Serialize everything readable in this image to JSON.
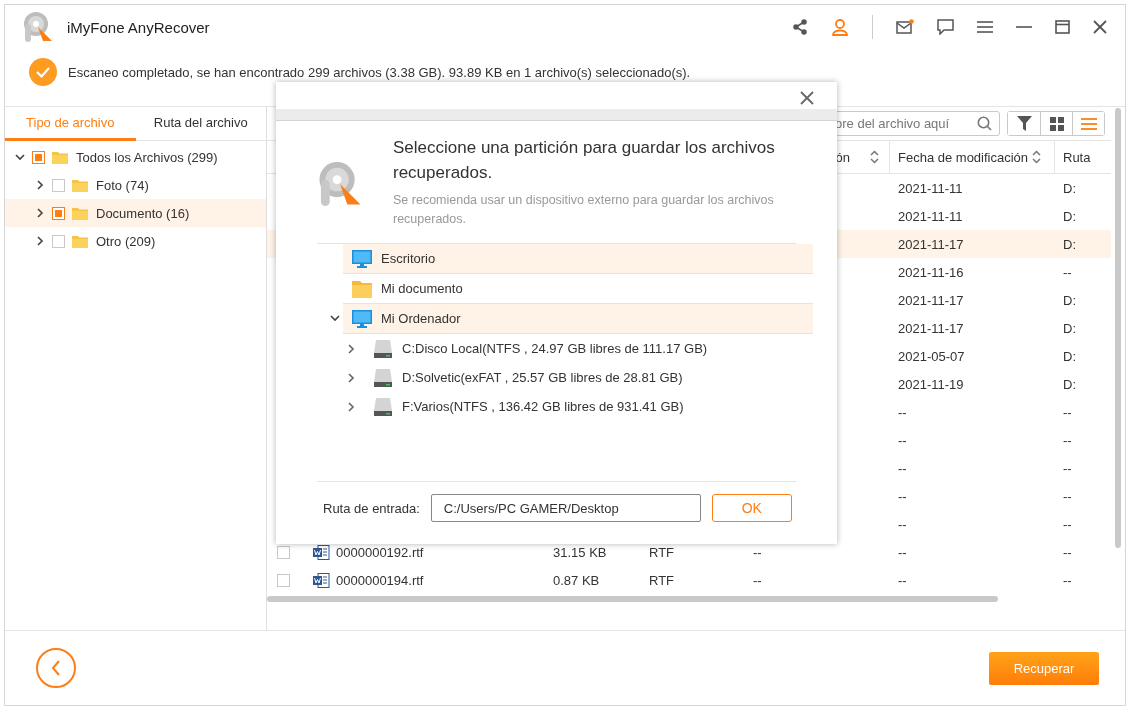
{
  "window": {
    "title": "iMyFone AnyRecover"
  },
  "status": {
    "message": "Escaneo completado, se han encontrado 299 archivos (3.38 GB). 93.89 KB en 1 archivo(s) seleccionado(s)."
  },
  "sidebar": {
    "tabs": [
      {
        "label": "Tipo de archivo",
        "selected": true
      },
      {
        "label": "Ruta del archivo",
        "selected": false
      }
    ],
    "tree": [
      {
        "label": "Todos los Archivos (299)",
        "indeterminate": true,
        "expanded": true,
        "selected": false,
        "children": [
          {
            "label": "Foto (74)",
            "indeterminate": false,
            "expanded": false,
            "selected": false
          },
          {
            "label": "Documento (16)",
            "indeterminate": true,
            "expanded": false,
            "selected": true
          },
          {
            "label": "Otro (209)",
            "indeterminate": false,
            "expanded": false,
            "selected": false
          }
        ]
      }
    ]
  },
  "search": {
    "placeholder": "ore del archivo aquí"
  },
  "view_buttons": [
    {
      "kind": "filter",
      "selected": false
    },
    {
      "kind": "grid",
      "selected": false
    },
    {
      "kind": "list",
      "selected": true
    }
  ],
  "table": {
    "columns": [
      {
        "label": "ón",
        "sortable": true
      },
      {
        "label": "Fecha de modificación",
        "sortable": true
      },
      {
        "label": "Ruta",
        "sortable": false
      }
    ],
    "rows": [
      {
        "modified": "2021-11-11",
        "path": "D:",
        "selected": false
      },
      {
        "modified": "2021-11-11",
        "path": "D:",
        "selected": false
      },
      {
        "modified": "2021-11-17",
        "path": "D:",
        "selected": true
      },
      {
        "modified": "2021-11-16",
        "path": "--",
        "selected": false
      },
      {
        "modified": "2021-11-17",
        "path": "D:",
        "selected": false
      },
      {
        "modified": "2021-11-17",
        "path": "D:",
        "selected": false
      },
      {
        "modified": "2021-05-07",
        "path": "D:",
        "selected": false
      },
      {
        "modified": "2021-11-19",
        "path": "D:",
        "selected": false
      },
      {
        "modified": "--",
        "path": "--",
        "selected": false
      },
      {
        "modified": "--",
        "path": "--",
        "selected": false
      },
      {
        "modified": "--",
        "path": "--",
        "selected": false
      },
      {
        "modified": "--",
        "path": "--",
        "selected": false
      },
      {
        "modified": "--",
        "path": "--",
        "selected": false
      },
      {
        "checked": false,
        "name": "0000000192.rtf",
        "size": "31.15 KB",
        "type": "RTF",
        "created": "--",
        "modified": "--",
        "path": "--",
        "selected": false
      },
      {
        "checked": false,
        "name": "0000000194.rtf",
        "size": "0.87 KB",
        "type": "RTF",
        "created": "--",
        "modified": "--",
        "path": "--",
        "selected": false
      }
    ]
  },
  "dialog": {
    "title": "Seleccione una partición para guardar los archivos recuperados.",
    "hint": "Se recomienda usar un dispositivo externo para guardar los archivos recuperados.",
    "locations": [
      {
        "kind": "desktop",
        "label": "Escritorio",
        "selected": true
      },
      {
        "kind": "folder",
        "label": "Mi documento",
        "selected": false
      },
      {
        "kind": "computer",
        "label": "Mi Ordenador",
        "selected": true,
        "expanded": true,
        "children": [
          {
            "kind": "drive",
            "label": "C:Disco Local(NTFS , 24.97 GB libres de 111.17 GB)",
            "expanded": false,
            "selected": false
          },
          {
            "kind": "drive",
            "label": "D:Solvetic(exFAT , 25.57 GB libres de 28.81 GB)",
            "expanded": false,
            "selected": false
          },
          {
            "kind": "drive",
            "label": "F:Varios(NTFS , 136.42 GB libres de 931.41 GB)",
            "expanded": false,
            "selected": false
          }
        ]
      }
    ],
    "path_label": "Ruta de entrada:",
    "path_value": "C:/Users/PC GAMER/Desktop",
    "ok_button": "OK"
  },
  "footer": {
    "recover_button": "Recuperar"
  }
}
